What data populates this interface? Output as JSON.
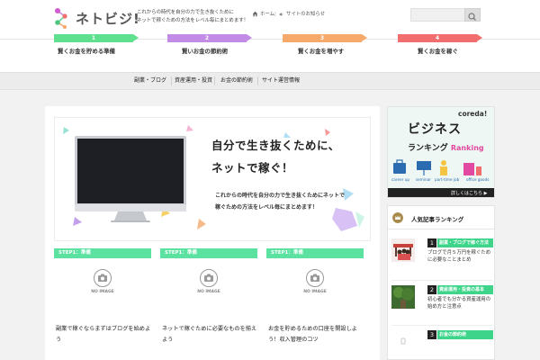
{
  "site": {
    "logo_text": "ネトビジ!",
    "tagline_line1": "これからの時代を自分の力で生き抜くために",
    "tagline_line2": "ネットで稼ぐための方法をレベル毎にまとめます！",
    "top_nav": {
      "home_label": "ホーム",
      "separator": "|",
      "news_label": "サイトのお知らせ"
    },
    "search": {
      "placeholder": ""
    }
  },
  "steps": [
    {
      "num": "1",
      "label": "賢くお金を貯める準備",
      "color": "#5fe08e"
    },
    {
      "num": "2",
      "label": "賢いお金の節約術",
      "color": "#c28be6"
    },
    {
      "num": "3",
      "label": "賢くお金を増やす",
      "color": "#f5a96a"
    },
    {
      "num": "4",
      "label": "賢くお金を稼ぐ",
      "color": "#f26d6d"
    }
  ],
  "gnav": [
    "副業・ブログ",
    "資産運用・投資",
    "お金の節約術",
    "サイト運営情報"
  ],
  "hero": {
    "title_line1": "自分で生き抜くために、",
    "title_line2": "ネットで稼ぐ！",
    "sub_line1": "これからの時代を自分の力で生き抜くためにネットで",
    "sub_line2": "稼ぐための方法をレベル毎にまとめます！"
  },
  "cards": [
    {
      "tag": "STEP1：準備",
      "noimage": "NO IMAGE",
      "title": "副業で稼ぐならまずはブログを始めよう"
    },
    {
      "tag": "STEP1：準備",
      "noimage": "NO IMAGE",
      "title": "ネットで稼ぐために必要なものを揃えよう"
    },
    {
      "tag": "STEP1：準備",
      "noimage": "NO IMAGE",
      "title": "お金を貯めるための口座を開設しよう！収入管理のコツ"
    }
  ],
  "ad": {
    "brand": "coreda!",
    "title": "ビジネス",
    "sub": "ランキング",
    "sub_hl": "Ranking",
    "captions": [
      "career up",
      "seminar",
      "part-time job",
      "office goods"
    ],
    "link": "詳しくはこちら ▶"
  },
  "ranking": {
    "title": "人気記事ランキング",
    "items": [
      {
        "num": "1",
        "bar": "副業・ブログで稼ぐ方法",
        "text": "ブログで月５万円を稼ぐために必要なことまとめ"
      },
      {
        "num": "2",
        "bar": "資産運用・投資の基本",
        "text": "初心者でも分かる資産運用の始め方と注意点"
      },
      {
        "num": "3",
        "bar": "お金の節約術",
        "text": ""
      }
    ]
  },
  "colors": {
    "card_tag": "#5be1a0",
    "rank_bar": "#3ed489"
  }
}
